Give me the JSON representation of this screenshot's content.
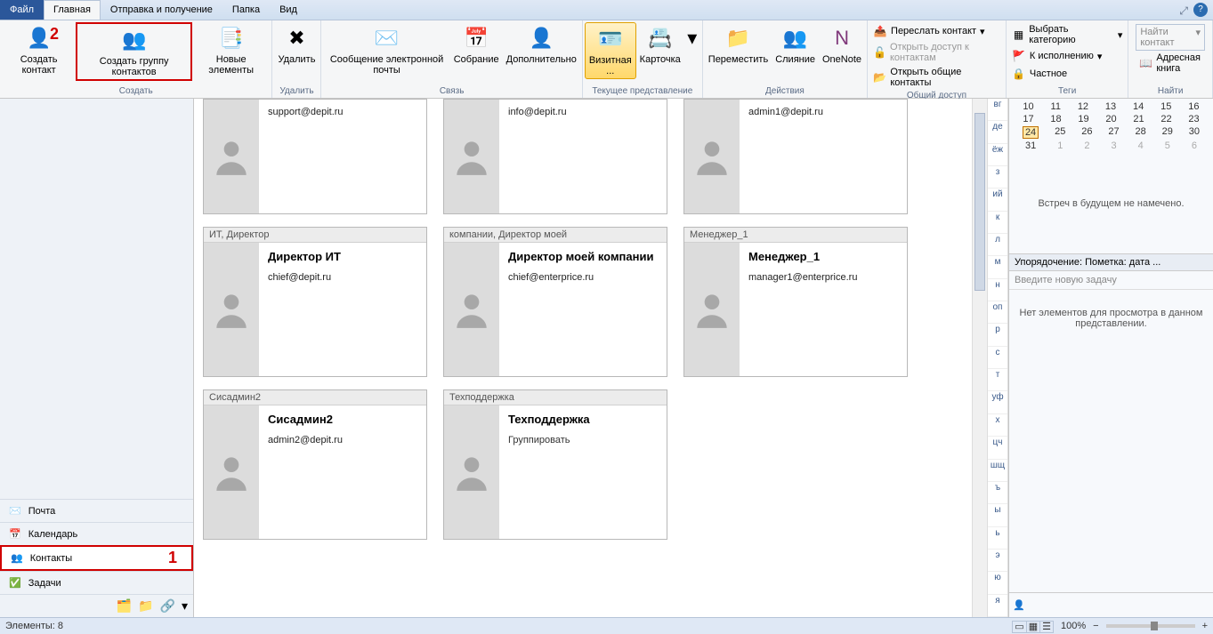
{
  "tabs": {
    "file": "Файл",
    "home": "Главная",
    "sendreceive": "Отправка и получение",
    "folder": "Папка",
    "view": "Вид"
  },
  "ribbon": {
    "create": {
      "label": "Создать",
      "new_contact": "Создать контакт",
      "new_group": "Создать группу контактов",
      "new_items": "Новые элементы"
    },
    "delete": {
      "label": "Удалить",
      "delete": "Удалить"
    },
    "comm": {
      "label": "Связь",
      "email": "Сообщение электронной почты",
      "meeting": "Собрание",
      "more": "Дополнительно"
    },
    "view": {
      "label": "Текущее представление",
      "card": "Визитная ...",
      "bizcard": "Карточка"
    },
    "actions": {
      "label": "Действия",
      "move": "Переместить",
      "merge": "Слияние",
      "onenote": "OneNote"
    },
    "share": {
      "label": "Общий доступ",
      "forward": "Переслать контакт",
      "open_access": "Открыть доступ к контактам",
      "open_shared": "Открыть общие контакты"
    },
    "tags": {
      "label": "Теги",
      "categorize": "Выбрать категорию",
      "followup": "К исполнению",
      "private": "Частное"
    },
    "find": {
      "label": "Найти",
      "search_placeholder": "Найти контакт",
      "addressbook": "Адресная книга"
    }
  },
  "annotations": {
    "one": "1",
    "two": "2"
  },
  "nav": {
    "mail": "Почта",
    "calendar": "Календарь",
    "contacts": "Контакты",
    "tasks": "Задачи"
  },
  "cards_row1": [
    {
      "header": "",
      "name": "",
      "email": "support@depit.ru"
    },
    {
      "header": "",
      "name": "",
      "email": "info@depit.ru"
    },
    {
      "header": "",
      "name": "",
      "email": "admin1@depit.ru"
    }
  ],
  "cards_row2": [
    {
      "header": "ИТ, Директор",
      "name": "Директор ИТ",
      "email": "chief@depit.ru"
    },
    {
      "header": "компании, Директор моей",
      "name": "Директор моей компании",
      "email": "chief@enterprice.ru"
    },
    {
      "header": "Менеджер_1",
      "name": "Менеджер_1",
      "email": "manager1@enterprice.ru"
    }
  ],
  "cards_row3": [
    {
      "header": "Сисадмин2",
      "name": "Сисадмин2",
      "email": "admin2@depit.ru"
    },
    {
      "header": "Техподдержка",
      "name": "Техподдержка",
      "sub": "Группировать"
    }
  ],
  "alpha": [
    "вг",
    "де",
    "ёж",
    "з",
    "ий",
    "к",
    "л",
    "м",
    "н",
    "оп",
    "р",
    "с",
    "т",
    "уф",
    "х",
    "цч",
    "шщ",
    "ъ",
    "ы",
    "ь",
    "э",
    "ю",
    "я"
  ],
  "calendar": {
    "rows": [
      [
        "10",
        "11",
        "12",
        "13",
        "14",
        "15",
        "16"
      ],
      [
        "17",
        "18",
        "19",
        "20",
        "21",
        "22",
        "23"
      ],
      [
        "24",
        "25",
        "26",
        "27",
        "28",
        "29",
        "30"
      ],
      [
        "31",
        "1",
        "2",
        "3",
        "4",
        "5",
        "6"
      ]
    ],
    "today": "24"
  },
  "right": {
    "no_meetings": "Встреч в будущем не намечено.",
    "task_sort": "Упорядочение: Пометка: дата ...",
    "task_input": "Введите новую задачу",
    "no_items": "Нет элементов для просмотра в данном представлении."
  },
  "status": {
    "items": "Элементы: 8",
    "zoom": "100%"
  }
}
